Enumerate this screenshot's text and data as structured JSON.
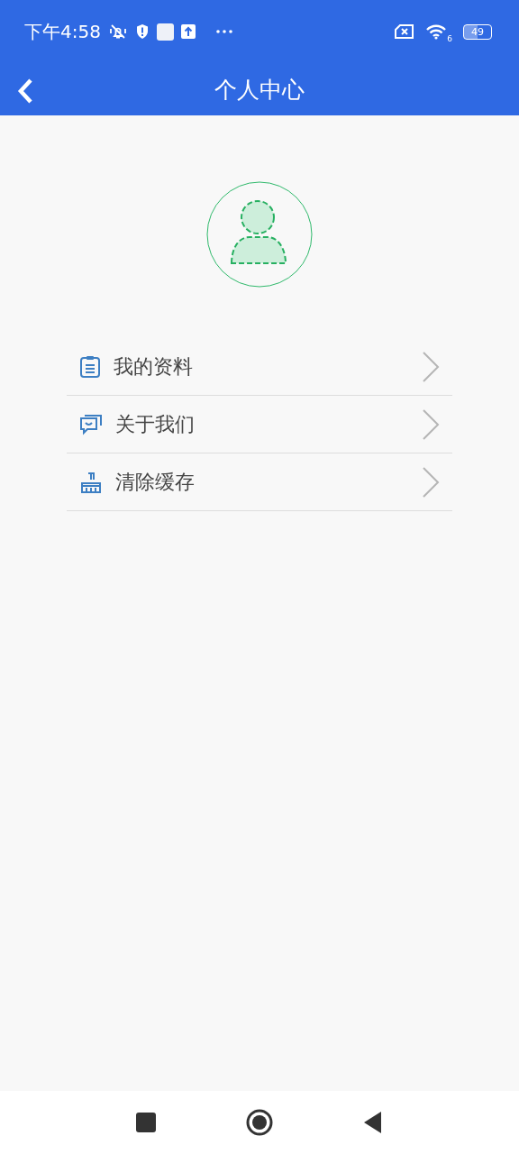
{
  "status_bar": {
    "time": "下午4:58",
    "wifi_badge": "6",
    "battery": "49"
  },
  "header": {
    "title": "个人中心"
  },
  "menu": [
    {
      "kind": "profile",
      "label": "我的资料"
    },
    {
      "kind": "about",
      "label": "关于我们"
    },
    {
      "kind": "cache",
      "label": "清除缓存"
    }
  ]
}
